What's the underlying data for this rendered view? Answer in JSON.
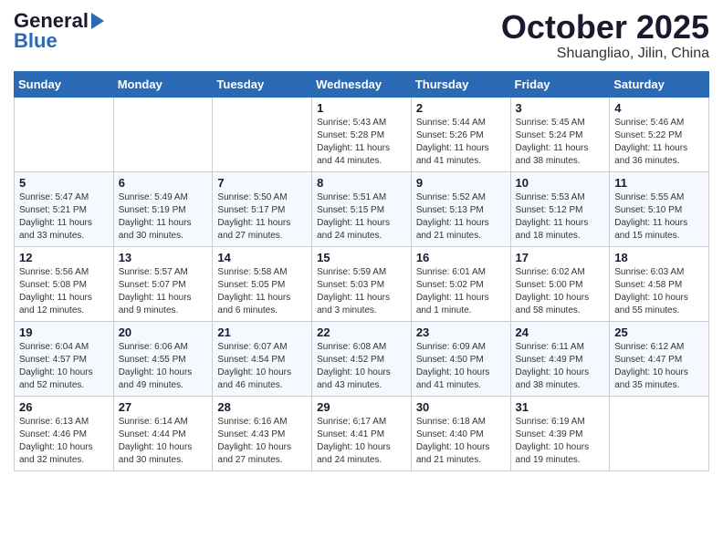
{
  "header": {
    "logo_general": "General",
    "logo_blue": "Blue",
    "month": "October 2025",
    "location": "Shuangliao, Jilin, China"
  },
  "weekdays": [
    "Sunday",
    "Monday",
    "Tuesday",
    "Wednesday",
    "Thursday",
    "Friday",
    "Saturday"
  ],
  "weeks": [
    [
      {
        "day": "",
        "info": ""
      },
      {
        "day": "",
        "info": ""
      },
      {
        "day": "",
        "info": ""
      },
      {
        "day": "1",
        "info": "Sunrise: 5:43 AM\nSunset: 5:28 PM\nDaylight: 11 hours\nand 44 minutes."
      },
      {
        "day": "2",
        "info": "Sunrise: 5:44 AM\nSunset: 5:26 PM\nDaylight: 11 hours\nand 41 minutes."
      },
      {
        "day": "3",
        "info": "Sunrise: 5:45 AM\nSunset: 5:24 PM\nDaylight: 11 hours\nand 38 minutes."
      },
      {
        "day": "4",
        "info": "Sunrise: 5:46 AM\nSunset: 5:22 PM\nDaylight: 11 hours\nand 36 minutes."
      }
    ],
    [
      {
        "day": "5",
        "info": "Sunrise: 5:47 AM\nSunset: 5:21 PM\nDaylight: 11 hours\nand 33 minutes."
      },
      {
        "day": "6",
        "info": "Sunrise: 5:49 AM\nSunset: 5:19 PM\nDaylight: 11 hours\nand 30 minutes."
      },
      {
        "day": "7",
        "info": "Sunrise: 5:50 AM\nSunset: 5:17 PM\nDaylight: 11 hours\nand 27 minutes."
      },
      {
        "day": "8",
        "info": "Sunrise: 5:51 AM\nSunset: 5:15 PM\nDaylight: 11 hours\nand 24 minutes."
      },
      {
        "day": "9",
        "info": "Sunrise: 5:52 AM\nSunset: 5:13 PM\nDaylight: 11 hours\nand 21 minutes."
      },
      {
        "day": "10",
        "info": "Sunrise: 5:53 AM\nSunset: 5:12 PM\nDaylight: 11 hours\nand 18 minutes."
      },
      {
        "day": "11",
        "info": "Sunrise: 5:55 AM\nSunset: 5:10 PM\nDaylight: 11 hours\nand 15 minutes."
      }
    ],
    [
      {
        "day": "12",
        "info": "Sunrise: 5:56 AM\nSunset: 5:08 PM\nDaylight: 11 hours\nand 12 minutes."
      },
      {
        "day": "13",
        "info": "Sunrise: 5:57 AM\nSunset: 5:07 PM\nDaylight: 11 hours\nand 9 minutes."
      },
      {
        "day": "14",
        "info": "Sunrise: 5:58 AM\nSunset: 5:05 PM\nDaylight: 11 hours\nand 6 minutes."
      },
      {
        "day": "15",
        "info": "Sunrise: 5:59 AM\nSunset: 5:03 PM\nDaylight: 11 hours\nand 3 minutes."
      },
      {
        "day": "16",
        "info": "Sunrise: 6:01 AM\nSunset: 5:02 PM\nDaylight: 11 hours\nand 1 minute."
      },
      {
        "day": "17",
        "info": "Sunrise: 6:02 AM\nSunset: 5:00 PM\nDaylight: 10 hours\nand 58 minutes."
      },
      {
        "day": "18",
        "info": "Sunrise: 6:03 AM\nSunset: 4:58 PM\nDaylight: 10 hours\nand 55 minutes."
      }
    ],
    [
      {
        "day": "19",
        "info": "Sunrise: 6:04 AM\nSunset: 4:57 PM\nDaylight: 10 hours\nand 52 minutes."
      },
      {
        "day": "20",
        "info": "Sunrise: 6:06 AM\nSunset: 4:55 PM\nDaylight: 10 hours\nand 49 minutes."
      },
      {
        "day": "21",
        "info": "Sunrise: 6:07 AM\nSunset: 4:54 PM\nDaylight: 10 hours\nand 46 minutes."
      },
      {
        "day": "22",
        "info": "Sunrise: 6:08 AM\nSunset: 4:52 PM\nDaylight: 10 hours\nand 43 minutes."
      },
      {
        "day": "23",
        "info": "Sunrise: 6:09 AM\nSunset: 4:50 PM\nDaylight: 10 hours\nand 41 minutes."
      },
      {
        "day": "24",
        "info": "Sunrise: 6:11 AM\nSunset: 4:49 PM\nDaylight: 10 hours\nand 38 minutes."
      },
      {
        "day": "25",
        "info": "Sunrise: 6:12 AM\nSunset: 4:47 PM\nDaylight: 10 hours\nand 35 minutes."
      }
    ],
    [
      {
        "day": "26",
        "info": "Sunrise: 6:13 AM\nSunset: 4:46 PM\nDaylight: 10 hours\nand 32 minutes."
      },
      {
        "day": "27",
        "info": "Sunrise: 6:14 AM\nSunset: 4:44 PM\nDaylight: 10 hours\nand 30 minutes."
      },
      {
        "day": "28",
        "info": "Sunrise: 6:16 AM\nSunset: 4:43 PM\nDaylight: 10 hours\nand 27 minutes."
      },
      {
        "day": "29",
        "info": "Sunrise: 6:17 AM\nSunset: 4:41 PM\nDaylight: 10 hours\nand 24 minutes."
      },
      {
        "day": "30",
        "info": "Sunrise: 6:18 AM\nSunset: 4:40 PM\nDaylight: 10 hours\nand 21 minutes."
      },
      {
        "day": "31",
        "info": "Sunrise: 6:19 AM\nSunset: 4:39 PM\nDaylight: 10 hours\nand 19 minutes."
      },
      {
        "day": "",
        "info": ""
      }
    ]
  ]
}
